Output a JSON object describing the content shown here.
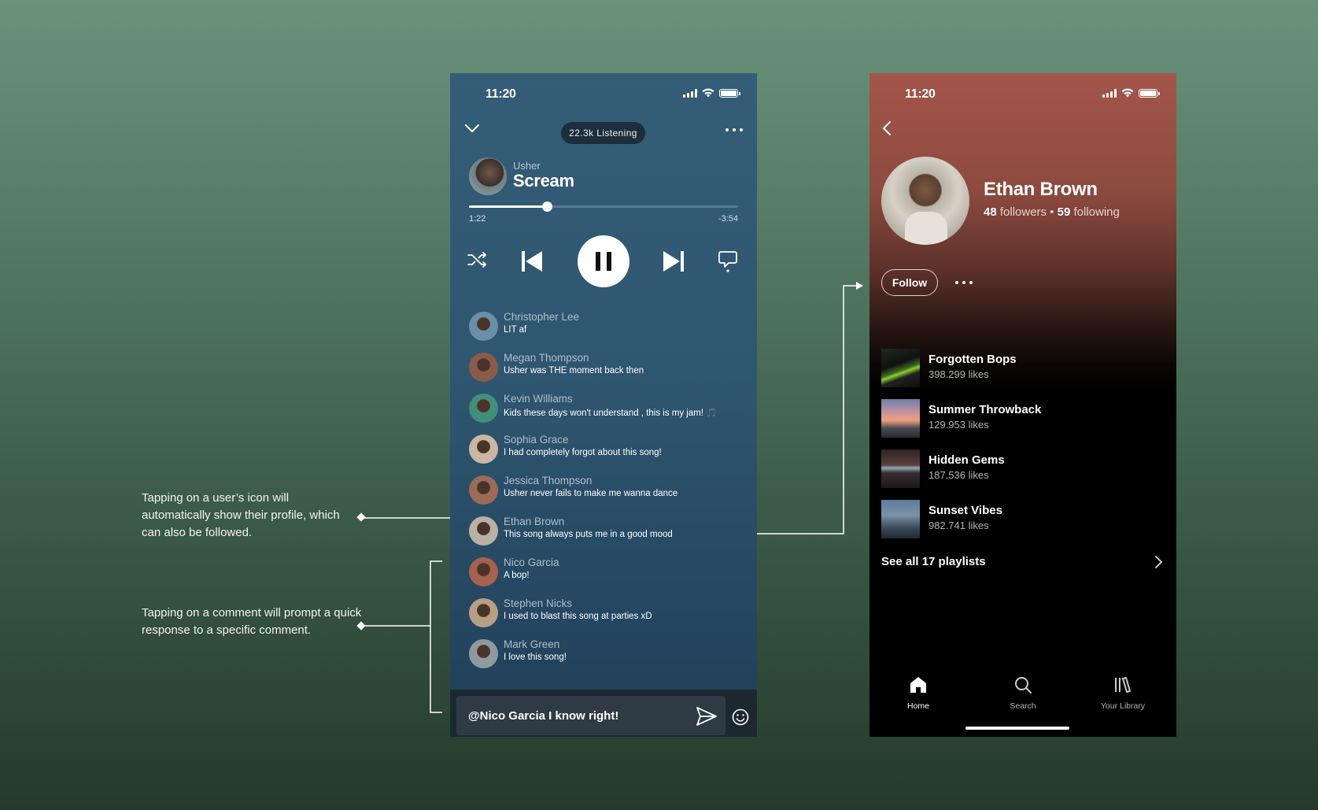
{
  "annotations": {
    "profile_note": "Tapping on a user’s icon will automatically show their profile, which can also be followed.",
    "comment_note": "Tapping on a comment will prompt a quick response to a specific comment."
  },
  "player": {
    "status_time": "11:20",
    "listening": "22.3k Listening",
    "artist": "Usher",
    "title": "Scream",
    "elapsed": "1:22",
    "remaining": "-3:54",
    "progress_fraction": 0.29,
    "comments": [
      {
        "name": "Christopher Lee",
        "text": "LIT af",
        "color": "#6a8fa6"
      },
      {
        "name": "Megan Thompson",
        "text": "Usher was THE moment back then",
        "color": "#8a5b4a"
      },
      {
        "name": "Kevin Williams",
        "text": "Kids these days won't understand , this is my jam! 🎵",
        "color": "#3f8f7a"
      },
      {
        "name": "Sophia Grace",
        "text": "I had completely forgot about this song!",
        "color": "#c9b7a4"
      },
      {
        "name": "Jessica Thompson",
        "text": "Usher never fails to make me wanna dance",
        "color": "#9b6b58"
      },
      {
        "name": "Ethan Brown",
        "text": "This song always puts me in a good mood",
        "color": "#b9b1a4"
      },
      {
        "name": "Nico Garcia",
        "text": "A bop!",
        "color": "#a5624e"
      },
      {
        "name": "Stephen Nicks",
        "text": "I used to blast this song at parties xD",
        "color": "#b99e86"
      },
      {
        "name": "Mark Green",
        "text": "I love this song!",
        "color": "#8f9aa0"
      }
    ],
    "input_value": "@Nico Garcia I know right!"
  },
  "profile": {
    "status_time": "11:20",
    "name": "Ethan Brown",
    "followers_count": "48",
    "followers_label": "followers",
    "following_count": "59",
    "following_label": "following",
    "follow_label": "Follow",
    "playlists": [
      {
        "name": "Forgotten Bops",
        "likes": "398.299 likes"
      },
      {
        "name": "Summer Throwback",
        "likes": "129.953 likes"
      },
      {
        "name": "Hidden Gems",
        "likes": "187.536 likes"
      },
      {
        "name": "Sunset Vibes",
        "likes": "982.741 likes"
      }
    ],
    "see_all": "See all 17 playlists",
    "tabs": {
      "home": "Home",
      "search": "Search",
      "library": "Your Library"
    }
  }
}
